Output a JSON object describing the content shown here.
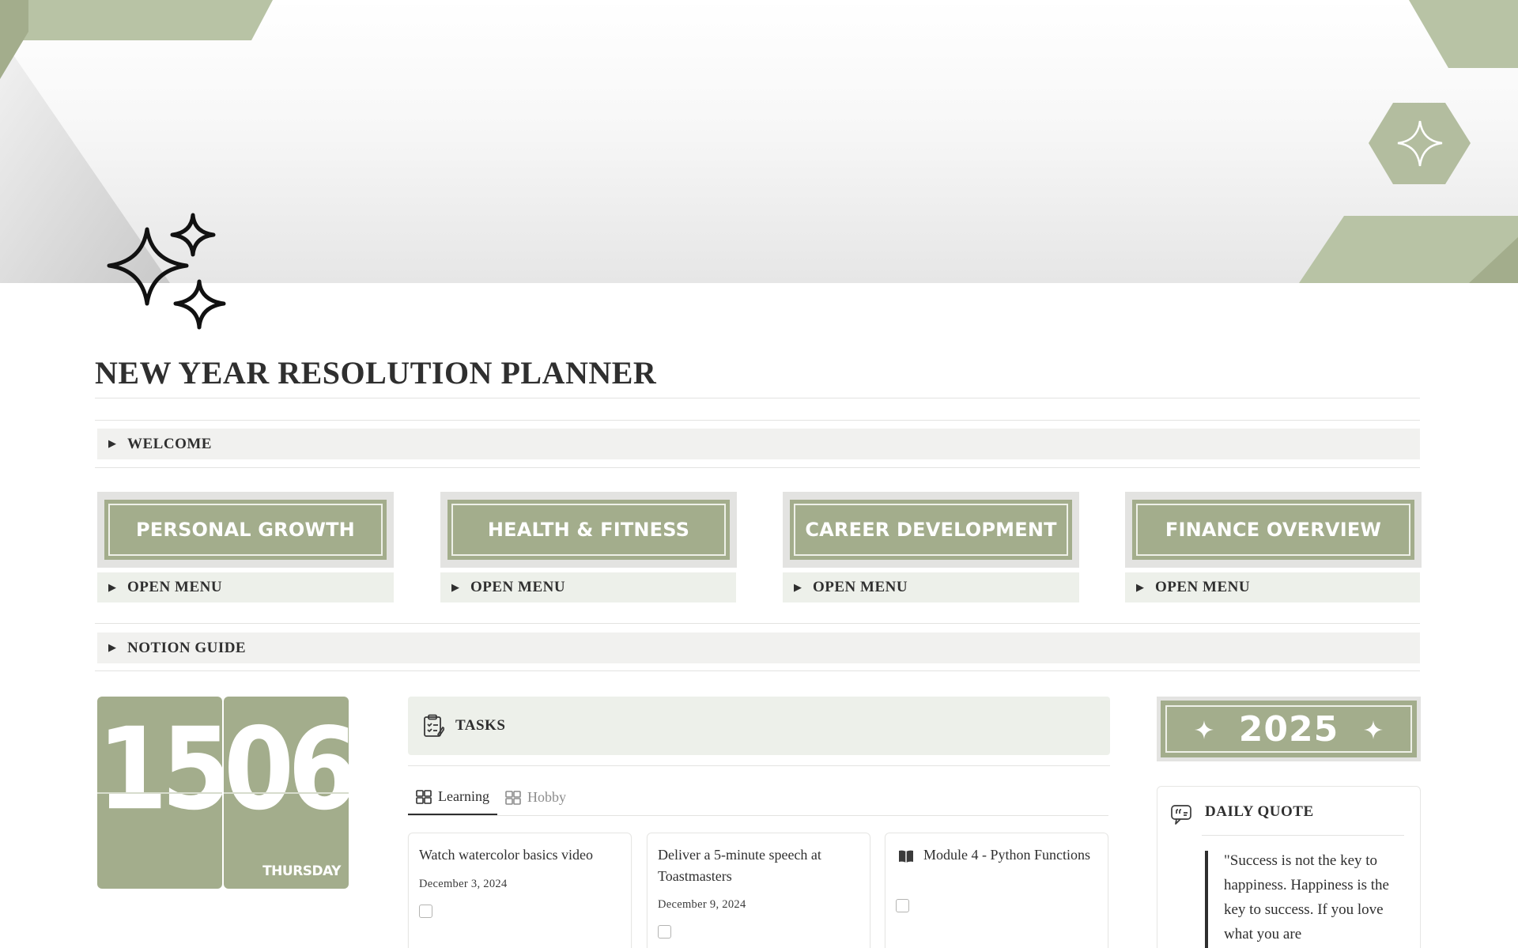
{
  "page": {
    "title": "NEW YEAR RESOLUTION PLANNER",
    "icon": "sparkles-icon",
    "cover_icon": "four-point-star-icon"
  },
  "colors": {
    "sage": "#a3ad8c",
    "sage_light": "#edf0ea",
    "gray_block": "#f1f1ef",
    "text": "#2f2f2f"
  },
  "welcome": {
    "label": "WELCOME"
  },
  "categories": [
    {
      "banner": "PERSONAL GROWTH",
      "menu": "OPEN MENU"
    },
    {
      "banner": "HEALTH & FITNESS",
      "menu": "OPEN MENU"
    },
    {
      "banner": "CAREER DEVELOPMENT",
      "menu": "OPEN MENU"
    },
    {
      "banner": "FINANCE OVERVIEW",
      "menu": "OPEN MENU"
    }
  ],
  "notion_guide": {
    "label": "NOTION GUIDE"
  },
  "clock": {
    "hours": "15",
    "minutes": "06",
    "day": "THURSDAY"
  },
  "tasks": {
    "header": "TASKS",
    "header_icon": "clipboard-icon",
    "tabs": [
      {
        "label": "Learning",
        "icon": "gallery-icon",
        "active": true
      },
      {
        "label": "Hobby",
        "icon": "gallery-icon",
        "active": false
      }
    ],
    "cards": [
      {
        "title": "Watch watercolor basics video",
        "date": "December 3, 2024",
        "checked": false
      },
      {
        "title": "Deliver a 5-minute speech at Toastmasters",
        "date": "December 9, 2024",
        "checked": false
      },
      {
        "title": "Module 4 - Python Functions",
        "date": "",
        "icon": "book-icon",
        "checked": false
      }
    ]
  },
  "year_banner": {
    "year": "2025"
  },
  "daily_quote": {
    "header": "DAILY QUOTE",
    "icon": "quote-bubble-icon",
    "text": "\"Success is not the key to happiness. Happiness is the key to success. If you love what you are"
  }
}
